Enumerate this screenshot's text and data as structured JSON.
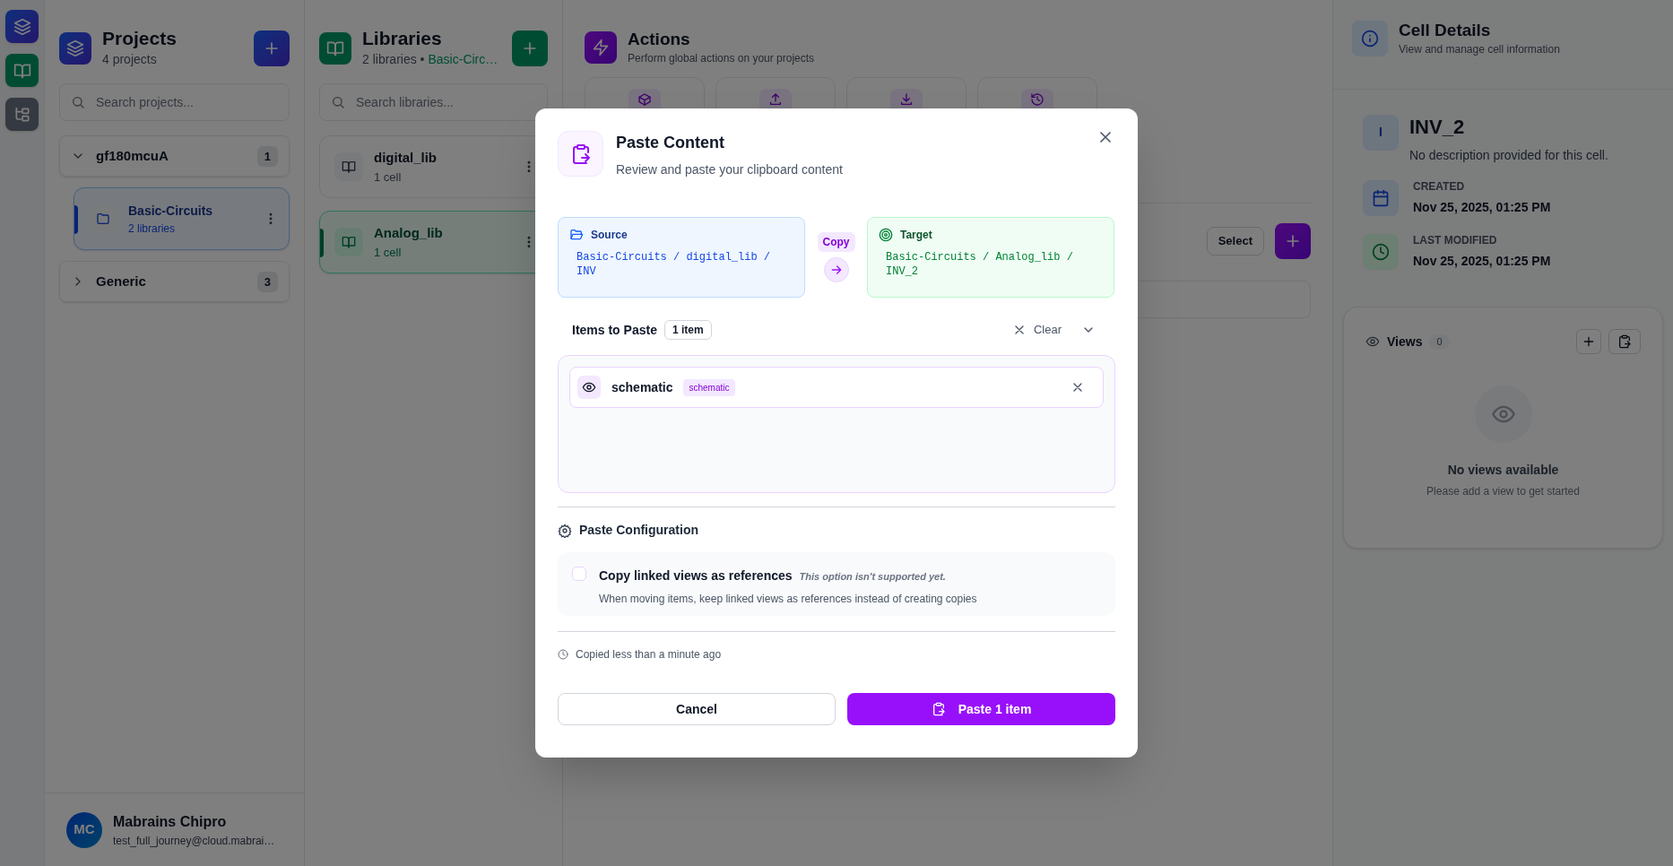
{
  "rail": [
    {
      "kind": "projects"
    },
    {
      "kind": "libraries"
    },
    {
      "kind": "hierarchy"
    }
  ],
  "projects": {
    "title": "Projects",
    "subtitle": "4 projects",
    "search_placeholder": "Search projects...",
    "groups": [
      {
        "name": "gf180mcuA",
        "count": "1",
        "expanded": true,
        "children": [
          {
            "name": "Basic-Circuits",
            "subtitle": "2 libraries",
            "selected": true
          }
        ]
      },
      {
        "name": "Generic",
        "count": "3",
        "expanded": false
      }
    ]
  },
  "libraries": {
    "title": "Libraries",
    "subtitle": "2 libraries •",
    "project": "Basic-Circ…",
    "search_placeholder": "Search libraries...",
    "items": [
      {
        "name": "digital_lib",
        "subtitle": "1 cell",
        "selected": false
      },
      {
        "name": "Analog_lib",
        "subtitle": "1 cell",
        "selected": true
      }
    ]
  },
  "actions": {
    "title": "Actions",
    "subtitle": "Perform global actions on your projects",
    "cards": [
      {
        "kind": "box"
      },
      {
        "kind": "upload"
      },
      {
        "kind": "download"
      },
      {
        "kind": "history"
      }
    ],
    "select_button": "Select"
  },
  "cell_details": {
    "title": "Cell Details",
    "subtitle": "View and manage cell information",
    "initial": "I",
    "name": "INV_2",
    "description": "No description provided for this cell.",
    "meta": [
      {
        "kind": "created",
        "label": "CREATED",
        "value": "Nov 25, 2025, 01:25 PM"
      },
      {
        "kind": "modified",
        "label": "LAST MODIFIED",
        "value": "Nov 25, 2025, 01:25 PM"
      }
    ],
    "views": {
      "title": "Views",
      "count": "0",
      "empty_title": "No views available",
      "empty_subtitle": "Please add a view to get started"
    }
  },
  "user": {
    "initials": "MC",
    "name": "Mabrains Chipro",
    "email": "test_full_journey@cloud.mabrai…"
  },
  "dialog": {
    "title": "Paste Content",
    "subtitle": "Review and paste your clipboard content",
    "source": {
      "label": "Source",
      "path": "Basic-Circuits / digital_lib / INV"
    },
    "mode": "Copy",
    "target": {
      "label": "Target",
      "path": "Basic-Circuits / Analog_lib / INV_2"
    },
    "items_title": "Items to Paste",
    "items_count": "1 item",
    "clear": "Clear",
    "items": [
      {
        "name": "schematic",
        "tag": "schematic"
      }
    ],
    "config_title": "Paste Configuration",
    "options": [
      {
        "label": "Copy linked views as references",
        "note": "This option isn't supported yet.",
        "description": "When moving items, keep linked views as references instead of creating copies",
        "checked": false
      }
    ],
    "footer_note": "Copied less than a minute ago",
    "cancel": "Cancel",
    "confirm": "Paste 1 item"
  }
}
